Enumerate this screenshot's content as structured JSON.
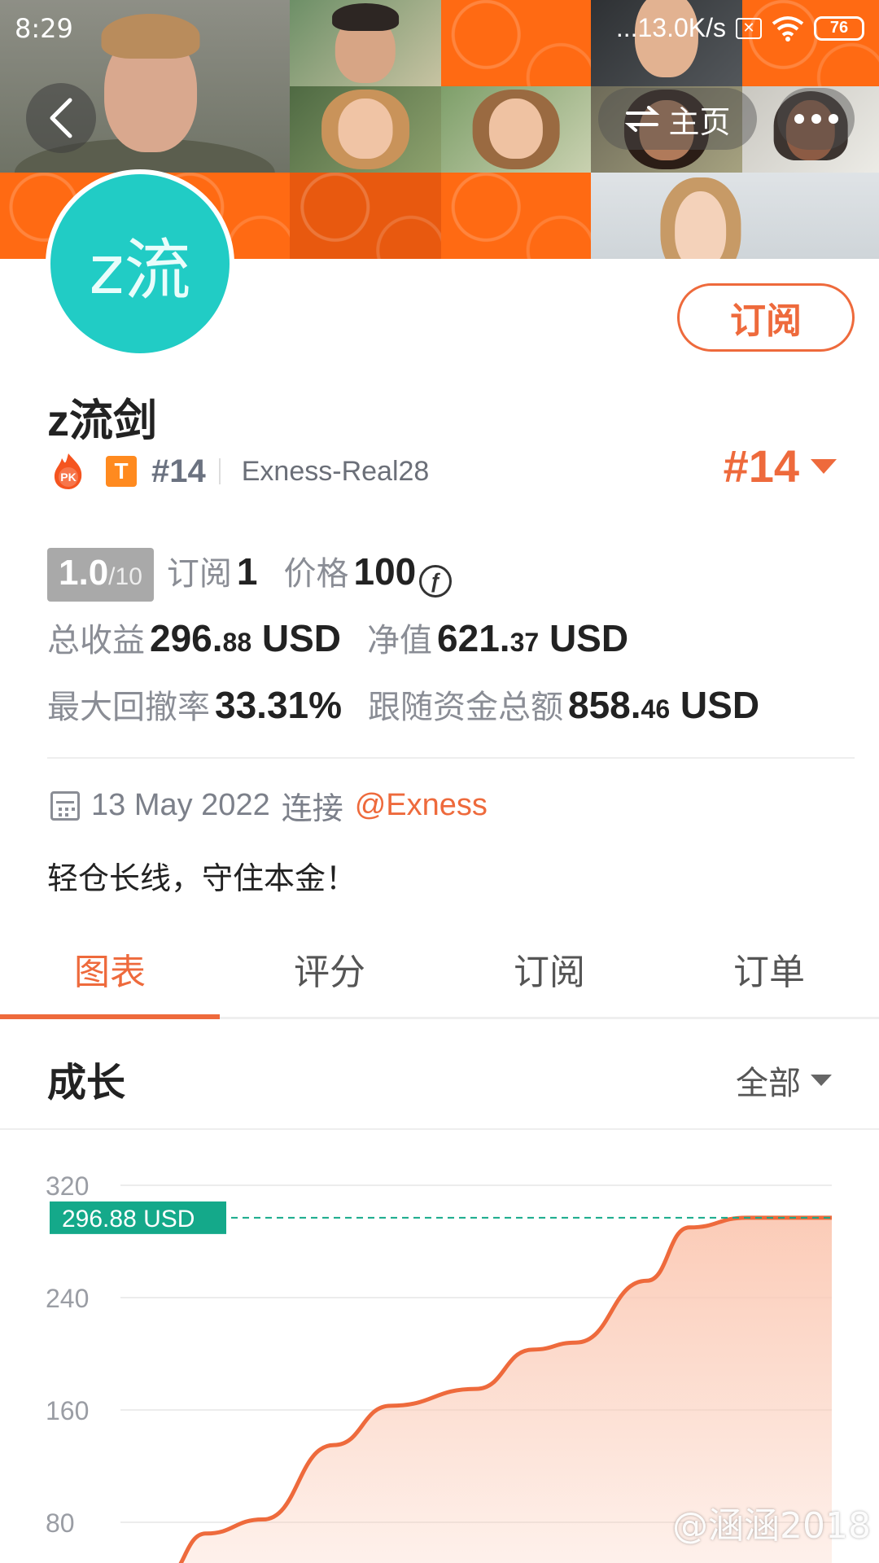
{
  "status_bar": {
    "time": "8:29",
    "network_speed": "...13.0K/s",
    "battery": "76"
  },
  "header": {
    "home_label": "主页",
    "subscribe_label": "订阅"
  },
  "profile": {
    "avatar_text": "z流",
    "name": "z流剑",
    "badge_letter": "T",
    "rank_small": "#14",
    "server": "Exness-Real28",
    "rank_big": "#14"
  },
  "stats": {
    "score": "1.0",
    "score_max": "/10",
    "subscribers_label": "订阅",
    "subscribers_value": "1",
    "price_label": "价格",
    "price_value": "100",
    "price_currency_icon": "f-coin-icon",
    "total_profit_label": "总收益",
    "total_profit_int": "296.",
    "total_profit_dec": "88",
    "total_profit_unit": "USD",
    "net_value_label": "净值",
    "net_value_int": "621.",
    "net_value_dec": "37",
    "net_value_unit": "USD",
    "max_drawdown_label": "最大回撤率",
    "max_drawdown_value": "33.31%",
    "follow_funds_label": "跟随资金总额",
    "follow_funds_int": "858.",
    "follow_funds_dec": "46",
    "follow_funds_unit": "USD"
  },
  "connection": {
    "date": "13 May 2022",
    "connect_text": "连接",
    "broker": "@Exness"
  },
  "bio": "轻仓长线，守住本金！",
  "tabs": [
    {
      "label": "图表",
      "active": true
    },
    {
      "label": "评分",
      "active": false
    },
    {
      "label": "订阅",
      "active": false
    },
    {
      "label": "订单",
      "active": false
    }
  ],
  "growth": {
    "title": "成长",
    "range_label": "全部"
  },
  "chart_data": {
    "type": "area",
    "y_ticks": [
      320,
      240,
      160,
      80
    ],
    "ylim": [
      0,
      320
    ],
    "current_value": 296.88,
    "current_label": "296.88 USD",
    "line_color": "#ee6a3c",
    "fill_color": "#fbc9b4",
    "marker_color": "#14a98a",
    "x": [
      0,
      0.06,
      0.12,
      0.2,
      0.3,
      0.38,
      0.5,
      0.58,
      0.64,
      0.74,
      0.8,
      0.88,
      1.0
    ],
    "values": [
      10,
      40,
      72,
      82,
      135,
      163,
      175,
      203,
      208,
      252,
      290,
      296.88,
      296.88
    ]
  },
  "watermark": "@涵涵2018",
  "colors": {
    "accent": "#ee6a3c",
    "avatar_bg": "#21ccc5",
    "banner": "#ff6a13"
  }
}
